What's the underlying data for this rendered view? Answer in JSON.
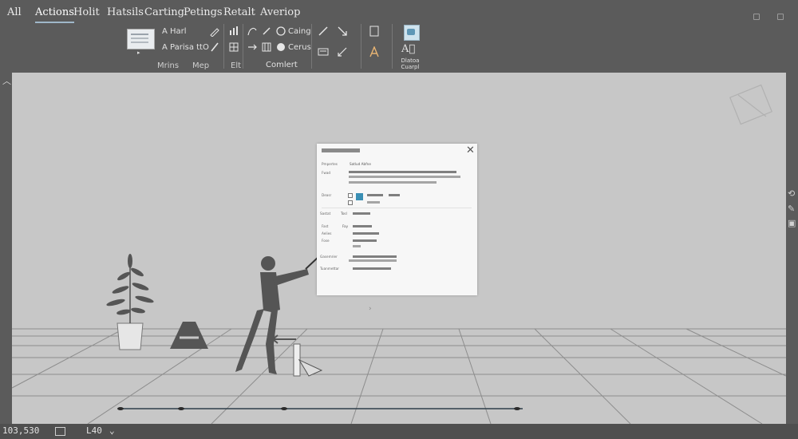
{
  "menu": {
    "tabs": [
      {
        "label": "All"
      },
      {
        "label": "Actions"
      },
      {
        "label": "Holit"
      },
      {
        "label": "Hatsils"
      },
      {
        "label": "Carting"
      },
      {
        "label": "Petings"
      },
      {
        "label": "Retalt"
      },
      {
        "label": "Averiop"
      }
    ]
  },
  "ribbon": {
    "font_name": "A Harl",
    "font_style": "A Parisa ttO",
    "shape_tool_label": "Caing",
    "effects_label": "Cerus",
    "convert_label": "Comlert",
    "group_labels": {
      "g1": "Mrins",
      "g2": "Mep",
      "g3": "Elt"
    },
    "image_tool_label": "Dlatoa Cuarpl"
  },
  "dialog": {
    "close_glyph": "✕",
    "row1_label": "Pmpertes",
    "row1_value": "Satlud Abfne",
    "row2_label": "Fwad",
    "row3_label": "Deasr",
    "row4_label": "Sastat",
    "row4_value": "Tosl",
    "row5_label": "Fast",
    "row5_value": "Fay",
    "row6_label": "Aelies",
    "row7_label": "Fose",
    "row8_label": "Gasemrier",
    "row9_label": "Tuanmettar",
    "scroll_caret": "›"
  },
  "status": {
    "coords": "103,530",
    "page": "L40"
  },
  "icons": {
    "font-icon": "font-glyph",
    "pen-icon": "pen",
    "arrow-icon": "cursor-arrow",
    "image-icon": "picture",
    "reset-view-icon": "perspective-frame",
    "side-shape-icon": "shape"
  },
  "colors": {
    "ribbon_bg": "#5b5b5b",
    "canvas_bg": "#c7c7c7",
    "dialog_bg": "#f7f7f7",
    "accent": "#3a8fb4"
  }
}
